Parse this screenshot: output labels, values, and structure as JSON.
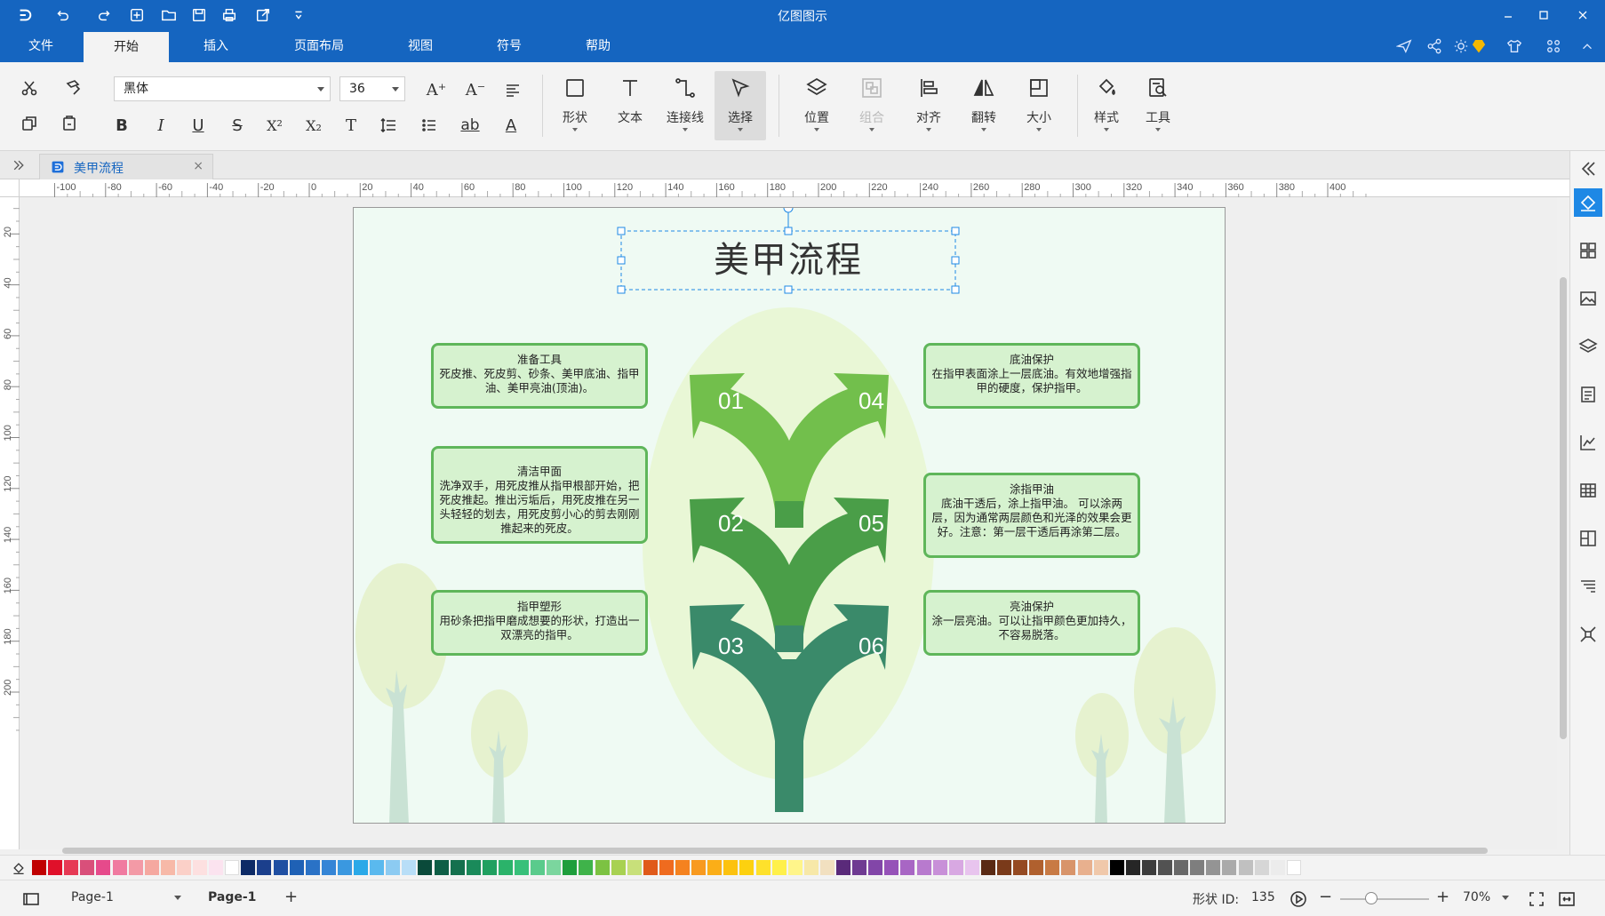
{
  "app": {
    "title": "亿图图示"
  },
  "menu": {
    "tabs": [
      {
        "label": "文件"
      },
      {
        "label": "开始"
      },
      {
        "label": "插入"
      },
      {
        "label": "页面布局"
      },
      {
        "label": "视图"
      },
      {
        "label": "符号"
      },
      {
        "label": "帮助"
      }
    ],
    "active": "开始"
  },
  "ribbon": {
    "font_name": "黑体",
    "font_size": "36",
    "buttons": [
      {
        "label": "形状"
      },
      {
        "label": "文本"
      },
      {
        "label": "连接线"
      },
      {
        "label": "选择"
      },
      {
        "label": "位置"
      },
      {
        "label": "组合"
      },
      {
        "label": "对齐"
      },
      {
        "label": "翻转"
      },
      {
        "label": "大小"
      },
      {
        "label": "样式"
      },
      {
        "label": "工具"
      }
    ],
    "format": {
      "bold": "B",
      "italic": "I",
      "underline": "U",
      "strike": "S",
      "superscript": "X²",
      "subscript": "X₂",
      "text_type": "T",
      "highlight": "ab",
      "font_color": "A",
      "grow": "A⁺",
      "shrink": "A⁻"
    }
  },
  "document": {
    "tab_label": "美甲流程",
    "tab_close": "×"
  },
  "ruler": {
    "h_labels": [
      "-100",
      "-80",
      "-60",
      "-40",
      "-20",
      "0",
      "20",
      "40",
      "60",
      "80",
      "100",
      "120",
      "140",
      "160",
      "180",
      "200",
      "220",
      "240",
      "260",
      "280",
      "300",
      "320",
      "340",
      "360",
      "380",
      "400"
    ],
    "v_labels": [
      "0",
      "20",
      "40",
      "60",
      "80",
      "100",
      "120",
      "140",
      "160",
      "180",
      "200"
    ]
  },
  "diagram": {
    "title": "美甲流程",
    "steps": [
      {
        "num": "01",
        "title": "准备工具",
        "text": "死皮推、死皮剪、砂条、美甲底油、指甲油、美甲亮油(顶油)。"
      },
      {
        "num": "02",
        "title": "清洁甲面",
        "text": "洗净双手，用死皮推从指甲根部开始，把死皮推起。推出污垢后，用死皮推在另一头轻轻的划去，用死皮剪小心的剪去刚刚推起来的死皮。"
      },
      {
        "num": "03",
        "title": "指甲塑形",
        "text": "用砂条把指甲磨成想要的形状，打造出一双漂亮的指甲。"
      },
      {
        "num": "04",
        "title": "底油保护",
        "text": "在指甲表面涂上一层底油。有效地增强指甲的硬度，保护指甲。"
      },
      {
        "num": "05",
        "title": "涂指甲油",
        "text": "底油干透后，涂上指甲油。 可以涂两层，因为通常两层颜色和光泽的效果会更好。注意：第一层干透后再涂第二层。"
      },
      {
        "num": "06",
        "title": "亮油保护",
        "text": "涂一层亮油。可以让指甲颜色更加持久，不容易脱落。"
      }
    ],
    "colors": {
      "arrow_top": "#72bf4c",
      "arrow_mid": "#4a9e48",
      "arrow_bottom": "#3a8a6a",
      "oval": "#e9f7d6",
      "tree": "#e6f2cf",
      "trunk": "#c9e2d4",
      "box_fill": "#d6f2cf",
      "box_border": "#5fb65a"
    }
  },
  "palette": {
    "colors": [
      "#c00000",
      "#e0102a",
      "#e63a55",
      "#d94f7a",
      "#e64a8b",
      "#f07aa0",
      "#f39aa6",
      "#f5a8a0",
      "#f7b9a8",
      "#fbd0c8",
      "#fde0e0",
      "#fbe3ef",
      "#ffffff",
      "#0d2a66",
      "#1b3f8c",
      "#1f4fa2",
      "#1f61b5",
      "#2a72c6",
      "#3585d6",
      "#3a98e0",
      "#2aa9e8",
      "#5ab9ee",
      "#8ccbf2",
      "#b8def7",
      "#0a4a3a",
      "#0e5e46",
      "#14704e",
      "#1a8a5a",
      "#20a060",
      "#2bb36a",
      "#38c07a",
      "#5acb8c",
      "#7bd69e",
      "#1e9e3c",
      "#3fb34a",
      "#7cc242",
      "#a8d152",
      "#c8e07a",
      "#e05a1a",
      "#ef6b1f",
      "#f5821f",
      "#f89a1f",
      "#fbae17",
      "#fcc20f",
      "#fdd10f",
      "#fee12b",
      "#fff04a",
      "#fff58a",
      "#f7e8a8",
      "#f2e0c0",
      "#5a2a7a",
      "#6f3a92",
      "#8246a8",
      "#9652b8",
      "#a866c4",
      "#b87ace",
      "#c890d8",
      "#d8a8e2",
      "#e8c4ee",
      "#5a2a14",
      "#7a3a1a",
      "#954a22",
      "#b0602e",
      "#c87a44",
      "#d8946a",
      "#e8b08e",
      "#f0c8aa",
      "#000000",
      "#262626",
      "#3c3c3c",
      "#525252",
      "#686868",
      "#7e7e7e",
      "#949494",
      "#aaaaaa",
      "#c0c0c0",
      "#d6d6d6",
      "#ececec",
      "#ffffff"
    ]
  },
  "status": {
    "page_selector": "Page-1",
    "page_tab": "Page-1",
    "add_page": "+",
    "shape_id_label": "形状 ID:",
    "shape_id_value": "135",
    "zoom": "70%",
    "zoom_level": 0.35
  }
}
